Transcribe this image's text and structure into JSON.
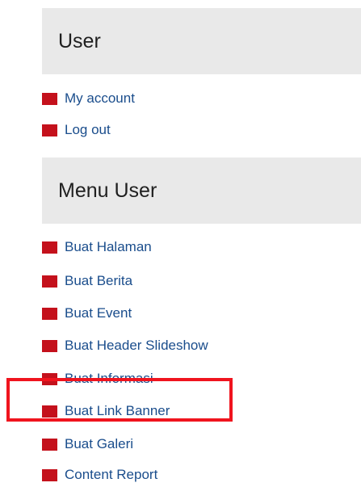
{
  "user_block": {
    "title": "User",
    "items": [
      {
        "label": "My account"
      },
      {
        "label": "Log out"
      }
    ]
  },
  "menu_user_block": {
    "title": "Menu User",
    "items": [
      {
        "label": "Buat Halaman"
      },
      {
        "label": "Buat Berita"
      },
      {
        "label": "Buat Event"
      },
      {
        "label": "Buat Header Slideshow"
      },
      {
        "label": "Buat Informasi"
      },
      {
        "label": "Buat Link Banner"
      },
      {
        "label": "Buat Galeri"
      },
      {
        "label": "Content Report"
      }
    ]
  },
  "colors": {
    "bullet": "#c4111c",
    "link": "#1a4d8c",
    "header_bg": "#e9e9e9",
    "highlight": "#f0141e"
  }
}
